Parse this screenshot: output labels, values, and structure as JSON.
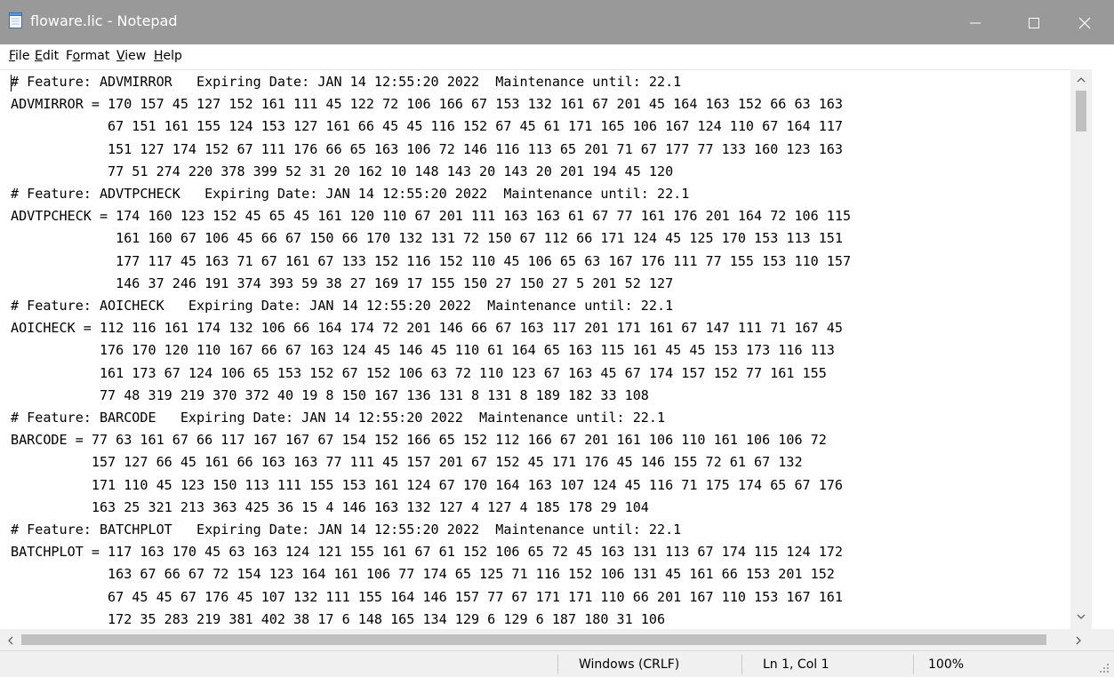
{
  "window": {
    "title": "floware.lic - Notepad"
  },
  "menu": {
    "file": {
      "u": "F",
      "rest": "ile"
    },
    "edit": {
      "u": "E",
      "rest": "dit"
    },
    "format": {
      "pre": "F",
      "u": "o",
      "rest": "rmat"
    },
    "view": {
      "u": "V",
      "rest": "iew"
    },
    "help": {
      "u": "H",
      "rest": "elp"
    }
  },
  "icons": {
    "app": "notepad-icon",
    "minimize": "minimize-icon",
    "maximize": "maximize-icon",
    "close": "close-icon",
    "scroll_up": "chevron-up-icon",
    "scroll_down": "chevron-down-icon",
    "scroll_left": "chevron-left-icon",
    "scroll_right": "chevron-right-icon",
    "resize": "resize-grip-icon"
  },
  "colors": {
    "titlebar": "#999999",
    "statusbar": "#f0f0f0",
    "scroll_thumb": "#c0c0c0"
  },
  "document": {
    "lines": [
      "# Feature: ADVMIRROR   Expiring Date: JAN 14 12:55:20 2022  Maintenance until: 22.1",
      "ADVMIRROR = 170 157 45 127 152 161 111 45 122 72 106 166 67 153 132 161 67 201 45 164 163 152 66 63 163",
      "            67 151 161 155 124 153 127 161 66 45 45 116 152 67 45 61 171 165 106 167 124 110 67 164 117",
      "            151 127 174 152 67 111 176 66 65 163 106 72 146 116 113 65 201 71 67 177 77 133 160 123 163",
      "            77 51 274 220 378 399 52 31 20 162 10 148 143 20 143 20 201 194 45 120",
      "# Feature: ADVTPCHECK   Expiring Date: JAN 14 12:55:20 2022  Maintenance until: 22.1",
      "ADVTPCHECK = 174 160 123 152 45 65 45 161 120 110 67 201 111 163 163 61 67 77 161 176 201 164 72 106 115",
      "             161 160 67 106 45 66 67 150 66 170 132 131 72 150 67 112 66 171 124 45 125 170 153 113 151",
      "             177 117 45 163 71 67 161 67 133 152 116 152 110 45 106 65 63 167 176 111 77 155 153 110 157",
      "             146 37 246 191 374 393 59 38 27 169 17 155 150 27 150 27 5 201 52 127",
      "# Feature: AOICHECK   Expiring Date: JAN 14 12:55:20 2022  Maintenance until: 22.1",
      "AOICHECK = 112 116 161 174 132 106 66 164 174 72 201 146 66 67 163 117 201 171 161 67 147 111 71 167 45",
      "           176 170 120 110 167 66 67 163 124 45 146 45 110 61 164 65 163 115 161 45 45 153 173 116 113",
      "           161 173 67 124 106 65 153 152 67 152 106 63 72 110 123 67 163 45 67 174 157 152 77 161 155",
      "           77 48 319 219 370 372 40 19 8 150 167 136 131 8 131 8 189 182 33 108",
      "# Feature: BARCODE   Expiring Date: JAN 14 12:55:20 2022  Maintenance until: 22.1",
      "BARCODE = 77 63 161 67 66 117 167 167 67 154 152 166 65 152 112 166 67 201 161 106 110 161 106 106 72",
      "          157 127 66 45 161 66 163 163 77 111 45 157 201 67 152 45 171 176 45 146 155 72 61 67 132",
      "          171 110 45 123 150 113 111 155 153 161 124 67 170 164 163 107 124 45 116 71 175 174 65 67 176",
      "          163 25 321 213 363 425 36 15 4 146 163 132 127 4 127 4 185 178 29 104",
      "# Feature: BATCHPLOT   Expiring Date: JAN 14 12:55:20 2022  Maintenance until: 22.1",
      "BATCHPLOT = 117 163 170 45 63 163 124 121 155 161 67 61 152 106 65 72 45 163 131 113 67 174 115 124 172",
      "            163 67 66 67 72 154 123 164 161 106 77 174 65 125 71 116 152 106 131 45 161 66 153 201 152",
      "            67 45 45 67 176 45 107 132 111 155 164 146 157 77 67 171 171 110 66 201 167 110 153 167 161",
      "            172 35 283 219 381 402 38 17 6 148 165 134 129 6 129 6 187 180 31 106"
    ]
  },
  "status": {
    "line_ending": "Windows (CRLF)",
    "position": "Ln 1, Col 1",
    "zoom": "100%"
  }
}
